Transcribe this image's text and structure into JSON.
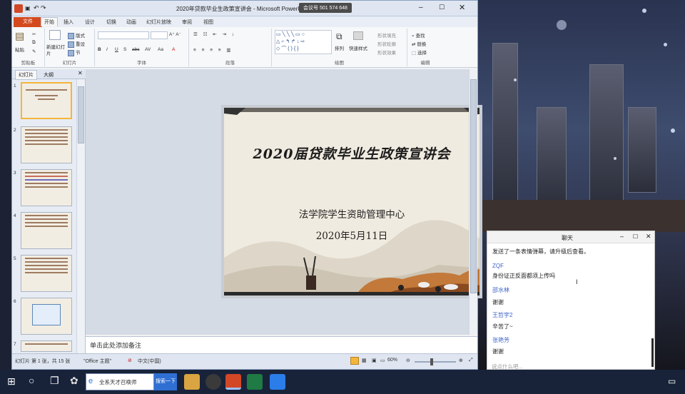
{
  "window": {
    "title": "2020年贷款毕业生政策宣讲会 - Microsoft PowerPoint",
    "meeting_id": "会议号 501 574 648"
  },
  "ribbon": {
    "file_tab": "文件",
    "tabs": [
      "开始",
      "插入",
      "设计",
      "切换",
      "动画",
      "幻灯片放映",
      "审阅",
      "视图"
    ],
    "clipboard": {
      "paste": "粘贴",
      "label": "剪贴板"
    },
    "slides": {
      "new_slide": "新建幻灯片",
      "layout": "版式",
      "reset": "重设",
      "section": "节",
      "label": "幻灯片"
    },
    "font": {
      "label": "字体",
      "buttons": [
        "B",
        "I",
        "U",
        "S",
        "abc",
        "AV",
        "Aa",
        "A"
      ]
    },
    "paragraph": {
      "label": "段落"
    },
    "drawing": {
      "label": "绘图",
      "arrange": "排列",
      "quick_styles": "快速样式",
      "fill": "形状填充",
      "outline": "形状轮廓",
      "effects": "形状效果"
    },
    "editing": {
      "label": "编辑",
      "find": "查找",
      "replace": "替换",
      "select": "选择"
    }
  },
  "panel_tabs": [
    "幻灯片",
    "大纲"
  ],
  "thumbnails": [
    "1",
    "2",
    "3",
    "4",
    "5",
    "6",
    "7"
  ],
  "slide": {
    "title": "2020届贷款毕业生政策宣讲会",
    "subtitle": "法学院学生资助管理中心",
    "date": "2020年5月11日"
  },
  "notes_placeholder": "单击此处添加备注",
  "statusbar": {
    "slide_info": "幻灯片 第 1 张，共 15 张",
    "theme": "\"Office 主题\"",
    "language": "中文(中国)",
    "zoom": "60%"
  },
  "chat": {
    "title": "聊天",
    "messages": [
      {
        "name": "",
        "text": "发送了一条表情弹幕，请升级后查看。"
      },
      {
        "name": "ZQF",
        "text": "身份证正反面都须上传吗"
      },
      {
        "name": "邵水林",
        "text": "谢谢"
      },
      {
        "name": "王哲宇2",
        "text": "辛苦了~"
      },
      {
        "name": "张艳芳",
        "text": "谢谢"
      }
    ],
    "input_placeholder": "说点什么吧..."
  },
  "taskbar": {
    "search_text": "全系天才召唤师",
    "search_button": "搜索一下"
  }
}
